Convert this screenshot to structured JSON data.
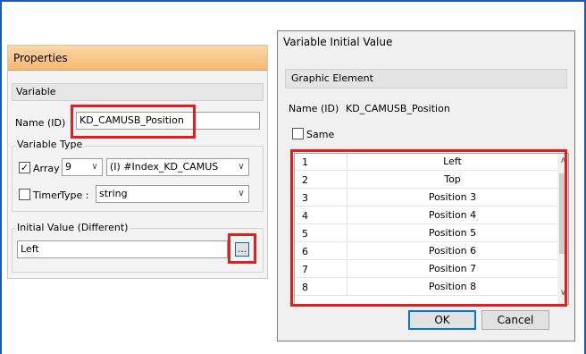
{
  "properties": {
    "title": "Properties",
    "section": "Variable",
    "name_label": "Name (ID)",
    "name_value": "KD_CAMUSB_Position",
    "variable_type_label": "Variable Type",
    "array_label": "Array",
    "array_checked": true,
    "array_size": "9",
    "array_index": "(I) #Index_KD_CAMUS",
    "timer_label": "Timer",
    "timer_checked": false,
    "type_label": "Type :",
    "type_value": "string",
    "initial_value_label": "Initial Value (Different)",
    "initial_value": "Left",
    "browse_label": "..."
  },
  "dialog": {
    "title": "Variable Initial Value",
    "section": "Graphic Element",
    "name_label": "Name (ID)",
    "name_value": "KD_CAMUSB_Position",
    "same_label": "Same",
    "same_checked": false,
    "rows": [
      {
        "index": "1",
        "value": "Left"
      },
      {
        "index": "2",
        "value": "Top"
      },
      {
        "index": "3",
        "value": "Position 3"
      },
      {
        "index": "4",
        "value": "Position 4"
      },
      {
        "index": "5",
        "value": "Position 5"
      },
      {
        "index": "6",
        "value": "Position 6"
      },
      {
        "index": "7",
        "value": "Position 7"
      },
      {
        "index": "8",
        "value": "Position 8"
      }
    ],
    "ok_label": "OK",
    "cancel_label": "Cancel"
  },
  "colors": {
    "highlight": "#e02020",
    "title_orange": "#f5b871",
    "accent_blue": "#1e5aa8"
  }
}
